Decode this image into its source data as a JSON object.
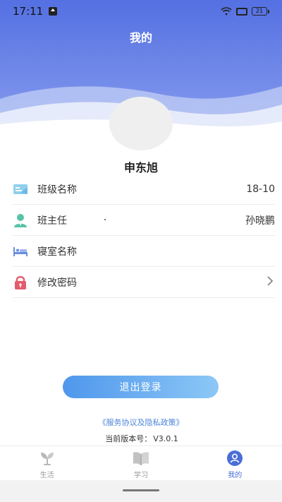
{
  "status_bar": {
    "time": "17:11",
    "battery": "21"
  },
  "header": {
    "title": "我的"
  },
  "profile": {
    "name": "申东旭"
  },
  "menu": {
    "items": [
      {
        "icon": "class-card-icon",
        "label": "班级名称",
        "value": "18-10"
      },
      {
        "icon": "teacher-icon",
        "label": "班主任",
        "value": "孙晓鹏"
      },
      {
        "icon": "bed-icon",
        "label": "寝室名称",
        "value": ""
      },
      {
        "icon": "lock-icon",
        "label": "修改密码",
        "value": ""
      }
    ]
  },
  "logout_label": "退出登录",
  "policy_link": "《服务协议及隐私政策》",
  "version": {
    "label": "当前版本号：",
    "value": "V3.0.1"
  },
  "tabs": [
    {
      "icon": "sprout-icon",
      "label": "生活"
    },
    {
      "icon": "book-icon",
      "label": "学习"
    },
    {
      "icon": "user-icon",
      "label": "我的"
    }
  ],
  "colors": {
    "header_top": "#5b78e3",
    "header_wave": "#8fa4ee",
    "accent": "#4a6ed8",
    "button_start": "#4f97ec",
    "button_end": "#8cc7f6",
    "link": "#4a84d9"
  }
}
